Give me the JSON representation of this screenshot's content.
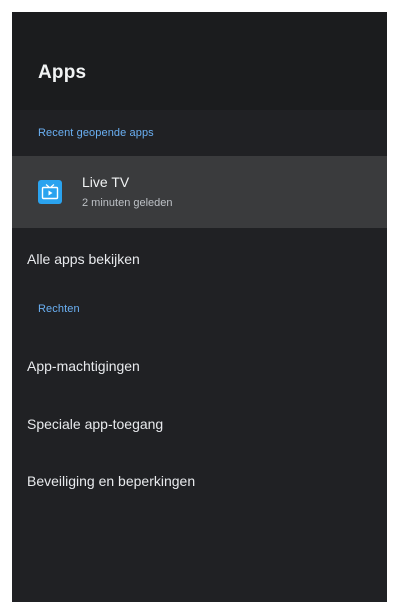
{
  "header": {
    "title": "Apps"
  },
  "recent": {
    "section_label": "Recent geopende apps",
    "items": [
      {
        "name": "Live TV",
        "time": "2 minuten geleden",
        "icon": "live-tv-icon",
        "icon_color": "#2aa3ef"
      }
    ]
  },
  "menu": {
    "all_apps": "Alle apps bekijken",
    "rights_label": "Rechten",
    "permissions": "App-machtigingen",
    "special_access": "Speciale app-toegang",
    "security": "Beveiliging en beperkingen"
  },
  "colors": {
    "panel_background": "#202124",
    "header_background": "#1b1c1e",
    "selected_background": "#3a3b3d",
    "accent": "#6ab0f3"
  }
}
